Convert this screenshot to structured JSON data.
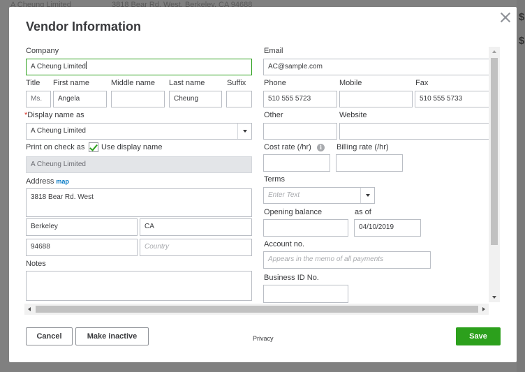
{
  "backdrop": {
    "vendor_name": "A Cheung Limited",
    "vendor_address": "3818 Bear Rd. West, Berkeley, CA 94688",
    "side_a": "$",
    "side_b": "$"
  },
  "dialog": {
    "title": "Vendor Information",
    "close_icon": "close-icon"
  },
  "form": {
    "company": {
      "label": "Company",
      "value": "A Cheung Limited"
    },
    "title": {
      "label": "Title",
      "placeholder": "Ms."
    },
    "first_name": {
      "label": "First name",
      "value": "Angela"
    },
    "middle_name": {
      "label": "Middle name",
      "value": ""
    },
    "last_name": {
      "label": "Last name",
      "value": "Cheung"
    },
    "suffix": {
      "label": "Suffix",
      "value": ""
    },
    "display_name": {
      "required_mark": "*",
      "label": "Display name as",
      "value": "A Cheung Limited"
    },
    "print_on_check": {
      "label": "Print on check as",
      "checkbox_label": "Use display name",
      "checked": true,
      "value": "A Cheung Limited"
    },
    "address": {
      "label": "Address",
      "map_link": "map",
      "street": "3818 Bear Rd. West",
      "city": "Berkeley",
      "state": "CA",
      "zip": "94688",
      "country_placeholder": "Country"
    },
    "notes": {
      "label": "Notes",
      "value": ""
    },
    "email": {
      "label": "Email",
      "value": "AC@sample.com"
    },
    "phone": {
      "label": "Phone",
      "value": "510 555 5723"
    },
    "mobile": {
      "label": "Mobile",
      "value": ""
    },
    "fax": {
      "label": "Fax",
      "value": "510 555 5733"
    },
    "other": {
      "label": "Other",
      "value": ""
    },
    "website": {
      "label": "Website",
      "value": ""
    },
    "cost_rate": {
      "label": "Cost rate (/hr)",
      "info_icon": "i",
      "value": ""
    },
    "billing_rate": {
      "label": "Billing rate (/hr)",
      "value": ""
    },
    "terms": {
      "label": "Terms",
      "placeholder": "Enter Text"
    },
    "opening_balance": {
      "label": "Opening balance",
      "value": ""
    },
    "as_of": {
      "label": "as of",
      "value": "04/10/2019"
    },
    "account_no": {
      "label": "Account no.",
      "placeholder": "Appears in the memo of all payments"
    },
    "business_id": {
      "label": "Business ID No.",
      "value": ""
    }
  },
  "footer": {
    "cancel": "Cancel",
    "make_inactive": "Make inactive",
    "privacy": "Privacy",
    "save": "Save"
  },
  "colors": {
    "primary_green": "#2ca01c",
    "required_red": "#d52b1e",
    "link_blue": "#0077c5"
  }
}
